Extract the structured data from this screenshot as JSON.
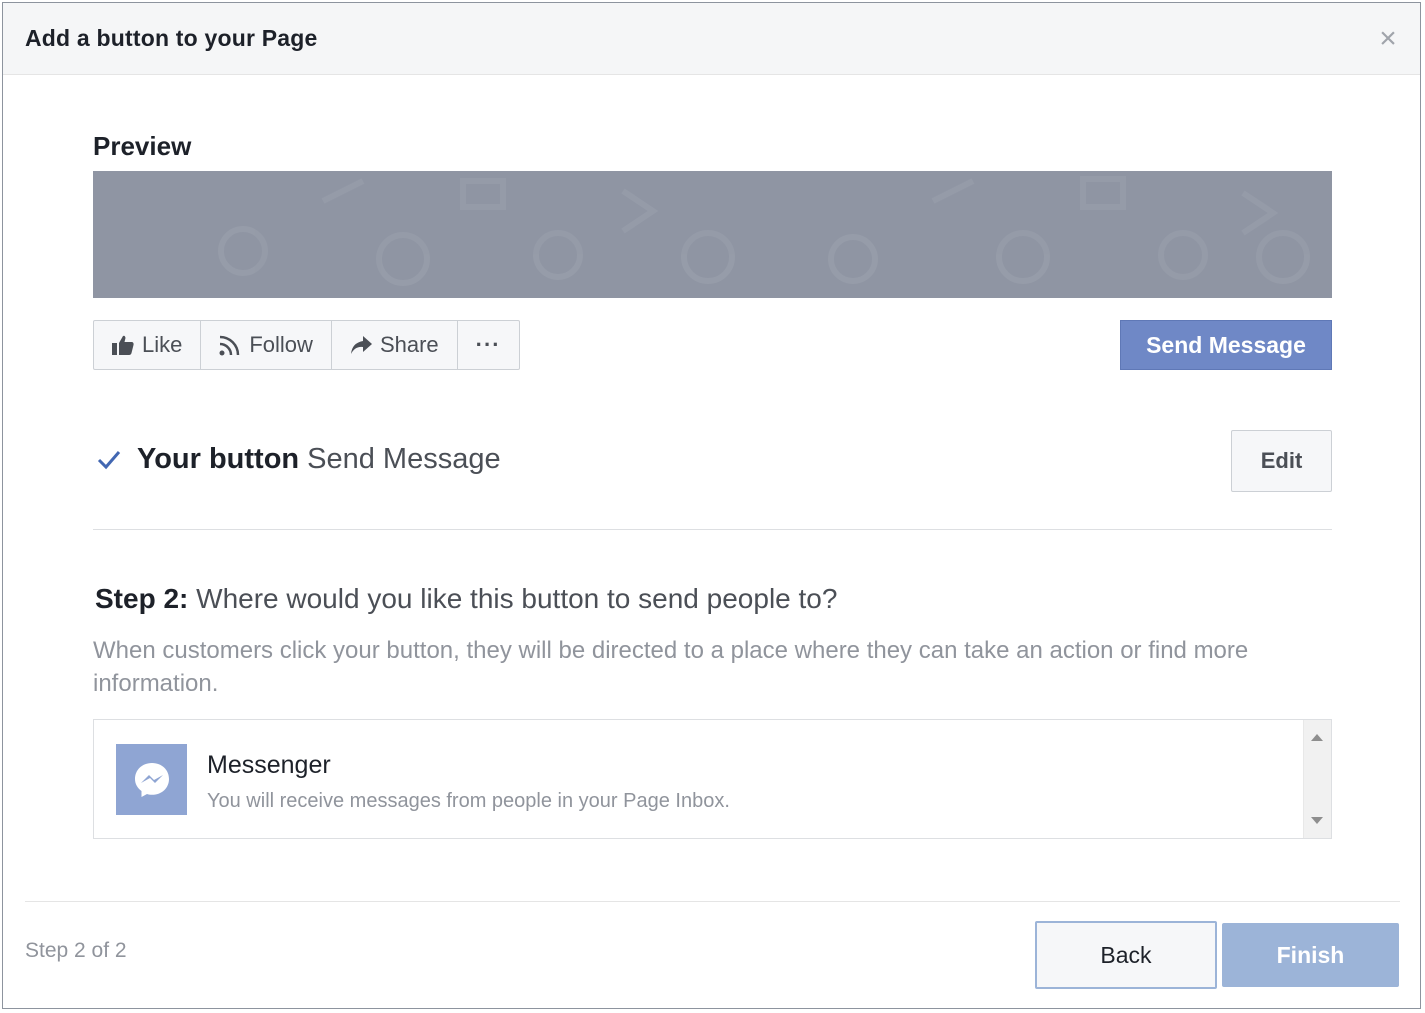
{
  "dialog": {
    "title": "Add a button to your Page",
    "close_icon": "close-icon"
  },
  "preview": {
    "label": "Preview",
    "actions": [
      {
        "label": "Like",
        "icon": "thumbs-up-icon"
      },
      {
        "label": "Follow",
        "icon": "rss-icon"
      },
      {
        "label": "Share",
        "icon": "share-arrow-icon"
      },
      {
        "label": "···",
        "icon": "more-icon"
      }
    ],
    "cta_label": "Send Message"
  },
  "your_button": {
    "label": "Your button",
    "value": "Send Message",
    "edit_label": "Edit"
  },
  "step2": {
    "prefix": "Step 2:",
    "question": "Where would you like this button to send people to?",
    "description": "When customers click your button, they will be directed to a place where they can take an action or find more information."
  },
  "option": {
    "title": "Messenger",
    "description": "You will receive messages from people in your Page Inbox.",
    "icon": "messenger-icon"
  },
  "footer": {
    "step_count": "Step 2 of 2",
    "back_label": "Back",
    "finish_label": "Finish"
  },
  "colors": {
    "accent": "#6f88c6",
    "disabled_accent": "#9cb4d8",
    "cover": "#8f95a3"
  }
}
